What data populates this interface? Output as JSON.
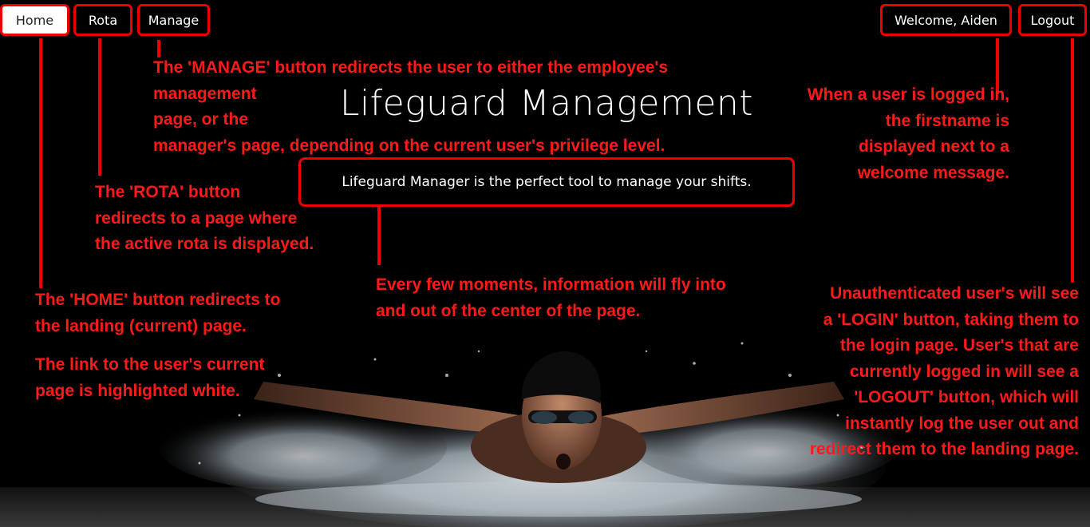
{
  "nav": {
    "home": "Home",
    "rota": "Rota",
    "manage": "Manage",
    "welcome": "Welcome, Aiden",
    "logout": "Logout"
  },
  "hero": {
    "title": "Lifeguard Management",
    "subtitle": "Lifeguard Manager is the perfect tool to manage your shifts."
  },
  "annotations": {
    "manage": [
      "The 'MANAGE' button redirects the user to either the employee's",
      "management",
      "page, or the",
      "manager's page, depending on the current user's privilege level."
    ],
    "rota": [
      "The 'ROTA' button",
      "redirects to a page where",
      "the active rota is displayed."
    ],
    "home": [
      "The 'HOME' button redirects to",
      "the landing (current) page."
    ],
    "highlight": [
      "The link to the user's current",
      "page is highlighted white."
    ],
    "info": [
      "Every few moments, information will fly into",
      "and out of the center of the page."
    ],
    "welcome": [
      "When a user is logged in,",
      "the firstname is",
      "displayed next to a",
      "welcome message."
    ],
    "logout": [
      "Unauthenticated user's will see",
      "a 'LOGIN' button, taking them to",
      "the login page. User's that are",
      "currently logged in will see a",
      "'LOGOUT' button, which will",
      "instantly log the user out and",
      "redirect them to the landing page."
    ]
  },
  "colors": {
    "annotation": "#ff1a1a",
    "border": "#e00000",
    "background": "#000000"
  }
}
